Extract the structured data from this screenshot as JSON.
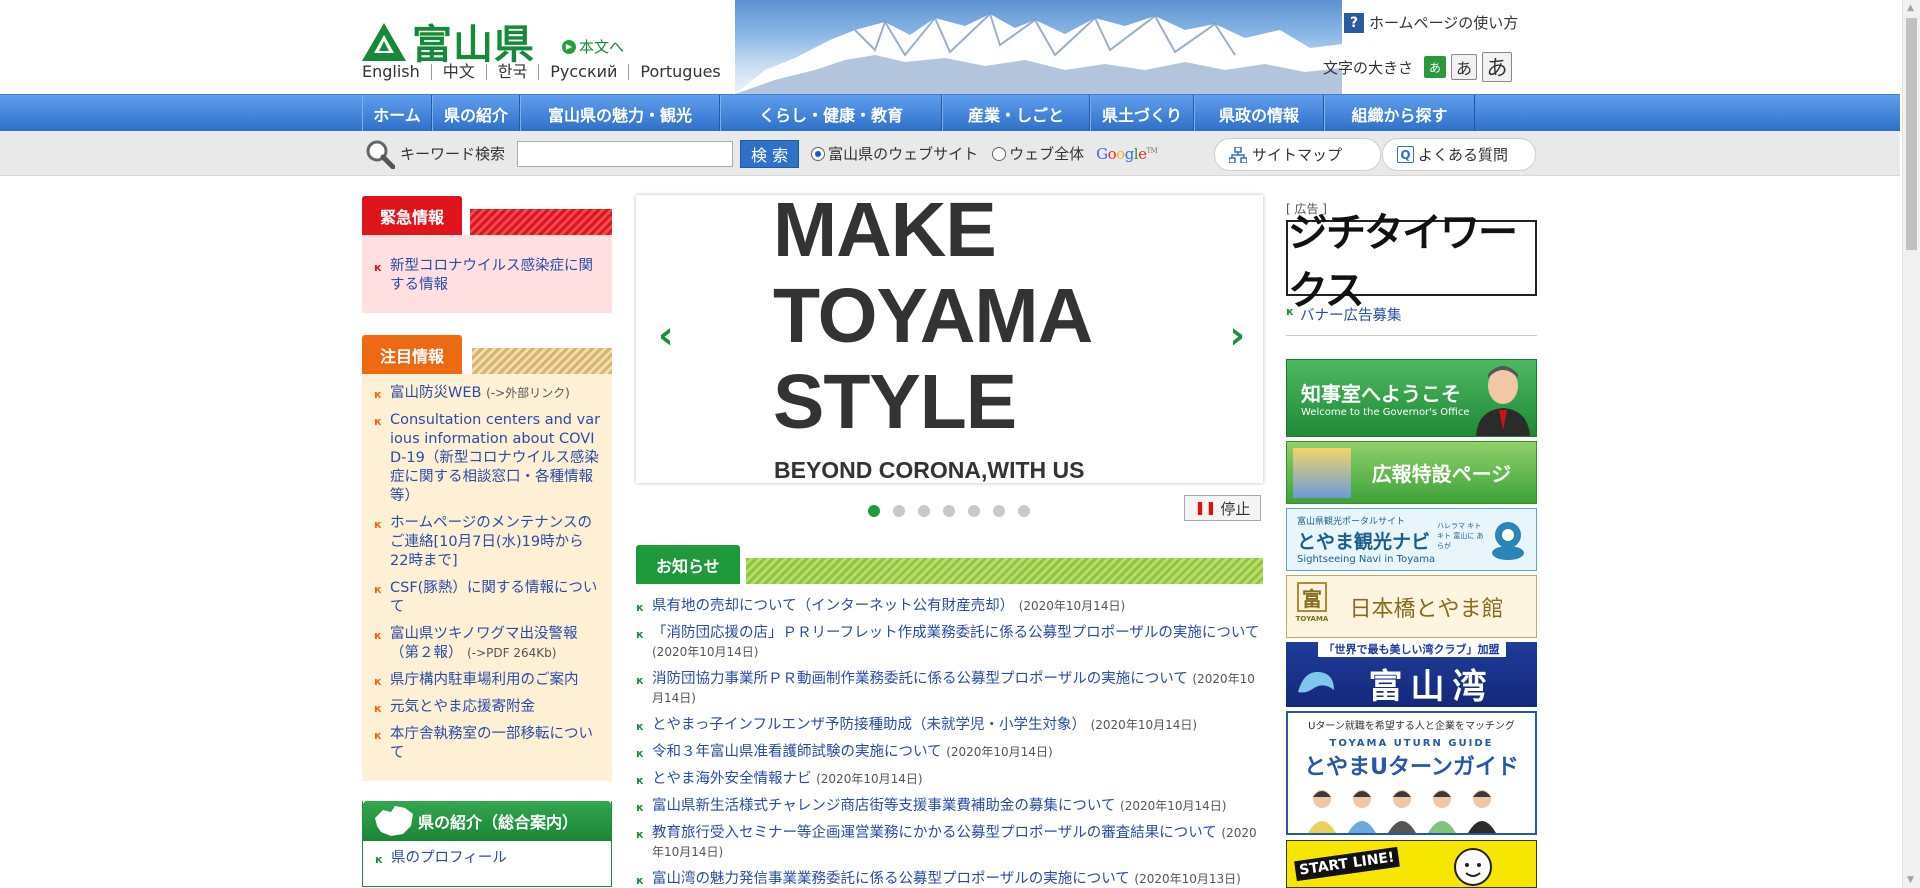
{
  "header": {
    "logo_text": "富山県",
    "skip_link": "本文へ",
    "languages": [
      "English",
      "中文",
      "한국",
      "Русский",
      "Portugues"
    ],
    "help_link": "ホームページの使い方",
    "font_size_label": "文字の大きさ",
    "font_sizes": [
      "あ",
      "あ",
      "あ"
    ]
  },
  "nav": {
    "items": [
      "ホーム",
      "県の紹介",
      "富山県の魅力・観光",
      "くらし・健康・教育",
      "産業・しごと",
      "県土づくり",
      "県政の情報",
      "組織から探す"
    ]
  },
  "search": {
    "label": "キーワード検索",
    "value": "",
    "button": "検 索",
    "option_site": "富山県のウェブサイト",
    "option_web": "ウェブ全体",
    "google": "Google",
    "google_tm": "TM",
    "sitemap": "サイトマップ",
    "faq": "よくある質問"
  },
  "emergency": {
    "title": "緊急情報",
    "items": [
      "新型コロナウイルス感染症に関する情報"
    ]
  },
  "attention": {
    "title": "注目情報",
    "items": [
      {
        "text": "富山防災WEB",
        "note": "(->外部リンク)"
      },
      {
        "text": "Consultation centers and various information about COVID-19（新型コロナウイルス感染症に関する相談窓口・各種情報等）",
        "note": ""
      },
      {
        "text": "ホームページのメンテナンスのご連絡[10月7日(水)19時から22時まで]",
        "note": ""
      },
      {
        "text": "CSF(豚熱）に関する情報について",
        "note": ""
      },
      {
        "text": "富山県ツキノワグマ出没警報（第２報）",
        "note": "(->PDF 264Kb)"
      },
      {
        "text": "県庁構内駐車場利用のご案内",
        "note": ""
      },
      {
        "text": "元気とやま応援寄附金",
        "note": ""
      },
      {
        "text": "本庁舎執務室の一部移転について",
        "note": ""
      }
    ]
  },
  "intro": {
    "title": "県の紹介（総合案内）",
    "items": [
      "県のプロフィール"
    ]
  },
  "slideshow": {
    "headline_lines": [
      "MAKE",
      "TOYAMA",
      "STYLE"
    ],
    "subline": "BEYOND CORONA,WITH US",
    "prev": "‹",
    "next": "›",
    "slide_count": 7,
    "active_index": 0,
    "stop_button": "停止"
  },
  "news": {
    "title": "お知らせ",
    "items": [
      {
        "text": "県有地の売却について（インターネット公有財産売却）",
        "date": "(2020年10月14日)"
      },
      {
        "text": "「消防団応援の店」ＰＲリーフレット作成業務委託に係る公募型プロポーザルの実施について",
        "date": "(2020年10月14日)"
      },
      {
        "text": "消防団協力事業所ＰＲ動画制作業務委託に係る公募型プロポーザルの実施について",
        "date": "(2020年10月14日)"
      },
      {
        "text": "とやまっ子インフルエンザ予防接種助成（未就学児・小学生対象）",
        "date": "(2020年10月14日)"
      },
      {
        "text": "令和３年富山県准看護師試験の実施について",
        "date": "(2020年10月14日)"
      },
      {
        "text": "とやま海外安全情報ナビ",
        "date": "(2020年10月14日)"
      },
      {
        "text": "富山県新生活様式チャレンジ商店街等支援事業費補助金の募集について",
        "date": "(2020年10月14日)"
      },
      {
        "text": "教育旅行受入セミナー等企画運営業務にかかる公募型プロポーザルの審査結果について",
        "date": "(2020年10月14日)"
      },
      {
        "text": "富山湾の魅力発信事業業務委託に係る公募型プロポーザルの実施について",
        "date": "(2020年10月13日)"
      }
    ]
  },
  "sidebar": {
    "ad_label": "[ 広告 ]",
    "ad_text": "ジチタイワークス",
    "banner_recruit": "バナー広告募集",
    "banners": [
      {
        "title": "知事室へようこそ",
        "sub": "Welcome to the Governor's Office"
      },
      {
        "title": "広報特設ページ",
        "sub": ""
      },
      {
        "title": "とやま観光ナビ",
        "sub": "Sightseeing Navi in Toyama",
        "top": "富山県観光ポータルサイト",
        "side": "ハレラマ キトキト 富山に あらが"
      },
      {
        "title": "日本橋とやま館",
        "sub": "TOYAMA",
        "icon": "富"
      },
      {
        "title": "富山湾",
        "sub": "「世界で最も美しい湾クラブ」加盟"
      },
      {
        "title": "とやまUターンガイド",
        "sub": "Uターン就職を希望する人と企業をマッチング",
        "top": "TOYAMA UTURN GUIDE"
      },
      {
        "title": "START LINE!",
        "sub": ""
      }
    ]
  },
  "colors": {
    "brand_green": "#178a3a",
    "nav_blue": "#2f70c8",
    "emergency_red": "#e0141b",
    "attention_orange": "#ee6a12",
    "link_blue": "#2a4ca8"
  }
}
